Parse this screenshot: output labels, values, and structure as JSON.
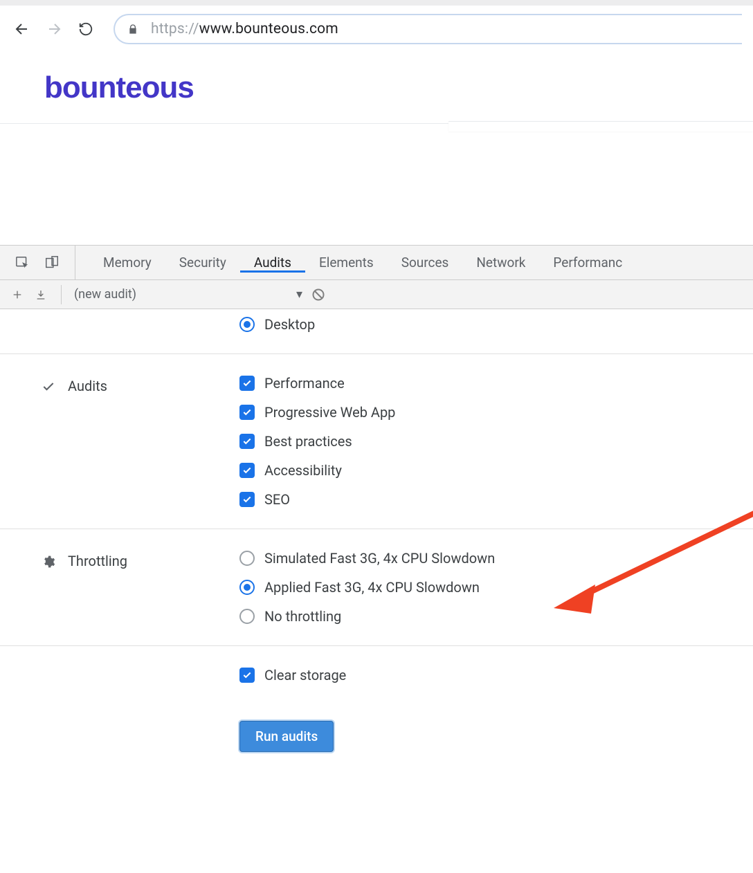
{
  "browser": {
    "url_scheme": "https://",
    "url_host": "www.bounteous.com",
    "url_path": ""
  },
  "page": {
    "logo_text": "bounteous"
  },
  "devtools": {
    "tabs": {
      "memory": "Memory",
      "security": "Security",
      "audits": "Audits",
      "elements": "Elements",
      "sources": "Sources",
      "network": "Network",
      "performance": "Performanc"
    },
    "active_tab": "audits",
    "subbar": {
      "audit_dropdown": "(new audit)"
    }
  },
  "audits": {
    "device": {
      "desktop": "Desktop"
    },
    "section_audits_label": "Audits",
    "checkboxes": {
      "performance": "Performance",
      "pwa": "Progressive Web App",
      "best_practices": "Best practices",
      "accessibility": "Accessibility",
      "seo": "SEO"
    },
    "section_throttling_label": "Throttling",
    "throttling": {
      "simulated": "Simulated Fast 3G, 4x CPU Slowdown",
      "applied": "Applied Fast 3G, 4x CPU Slowdown",
      "none": "No throttling"
    },
    "clear_storage": "Clear storage",
    "run_button": "Run audits"
  },
  "colors": {
    "accent": "#1a73e8",
    "brand": "#4336c7",
    "arrow": "#ef4123"
  }
}
